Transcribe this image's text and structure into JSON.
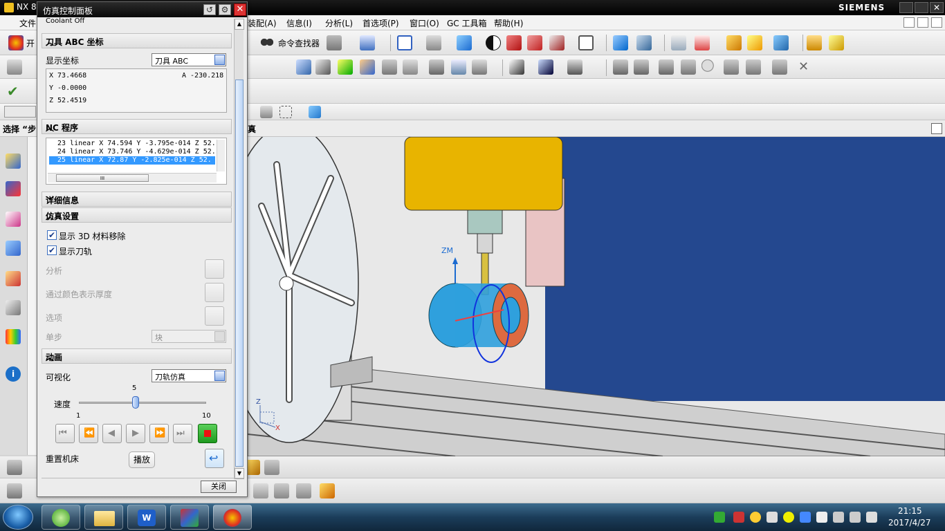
{
  "app": {
    "title": "NX 8",
    "brand": "SIEMENS"
  },
  "menu": [
    "文件",
    "开",
    "装配(A)",
    "信息(I)",
    "分析(L)",
    "首选项(P)",
    "窗口(O)",
    "GC 工具箱",
    "帮助(H)"
  ],
  "toolbar": {
    "command_finder": "命令查找器"
  },
  "selection_bar": {
    "label": "选择 “步"
  },
  "viewport": {
    "title_fragment": "真",
    "axis_zm": "ZM",
    "axis_z": "Z",
    "axis_x": "X"
  },
  "panel": {
    "title": "仿真控制面板",
    "coolant": "Coolant Off",
    "sections": {
      "coord": "刀具 ABC 坐标",
      "nc": "NC 程序",
      "details": "详细信息",
      "sim_settings": "仿真设置",
      "animation": "动画"
    },
    "display_coord": {
      "label": "显示坐标",
      "value": "刀具 ABC"
    },
    "coords": {
      "x": "X 73.4668",
      "y": "Y -0.0000",
      "z": "Z 52.4519",
      "a": "A -230.218"
    },
    "nc_lines": [
      "23 linear X 74.594 Y -3.795e-014 Z 52.",
      "24 linear X 73.746 Y -4.629e-014 Z 52.",
      "25 linear X 72.87 Y -2.825e-014 Z 52."
    ],
    "nc_selected_index": 2,
    "scroll_marker": "III",
    "settings": {
      "show_3d_removal": "显示 3D 材料移除",
      "show_toolpath": "显示刀轨",
      "analysis": "分析",
      "thickness_by_color": "通过颜色表示厚度",
      "options": "选项",
      "step": "单步",
      "step_value": "块"
    },
    "animation": {
      "visualization_label": "可视化",
      "visualization_value": "刀轨仿真",
      "speed_label": "速度",
      "speed_value": "5",
      "speed_min": "1",
      "speed_max": "10",
      "speed_fraction": 0.444,
      "reset_machine": "重置机床",
      "play": "播放"
    },
    "close": "关闭"
  },
  "taskbar": {
    "time": "21:15",
    "date": "2017/4/27"
  },
  "colors": {
    "accent": "#3399ff",
    "viewport_bg": "#24488f",
    "spindle": "#e8b400",
    "stop": "#ee1111"
  }
}
